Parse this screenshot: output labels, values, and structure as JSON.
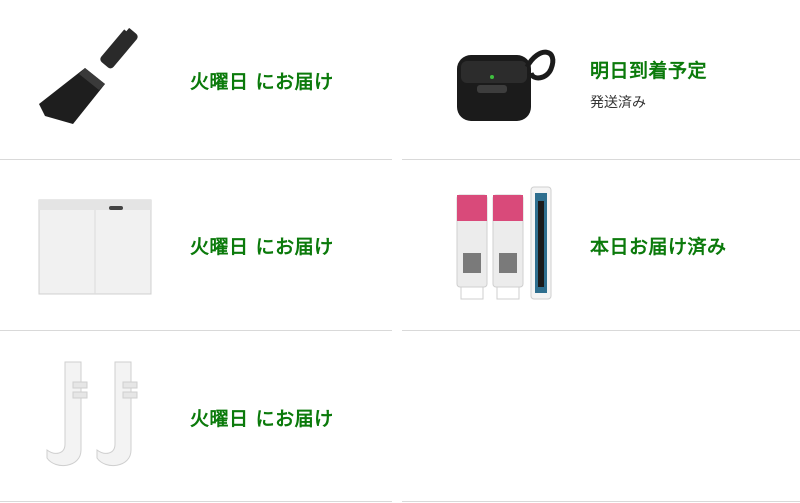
{
  "orders": {
    "left": [
      {
        "status": "火曜日 にお届け",
        "image_icon": "trowel-icon"
      },
      {
        "status": "火曜日 にお届け",
        "image_icon": "storage-box-icon"
      },
      {
        "status": "火曜日 にお届け",
        "image_icon": "hooks-icon"
      }
    ],
    "right": [
      {
        "status": "明日到着予定",
        "substatus": "発送済み",
        "image_icon": "earbuds-case-icon"
      },
      {
        "status": "本日お届け済み",
        "image_icon": "toothpaste-set-icon"
      }
    ]
  },
  "colors": {
    "status_green": "#0b7a0b",
    "divider": "#d9d9d9"
  }
}
